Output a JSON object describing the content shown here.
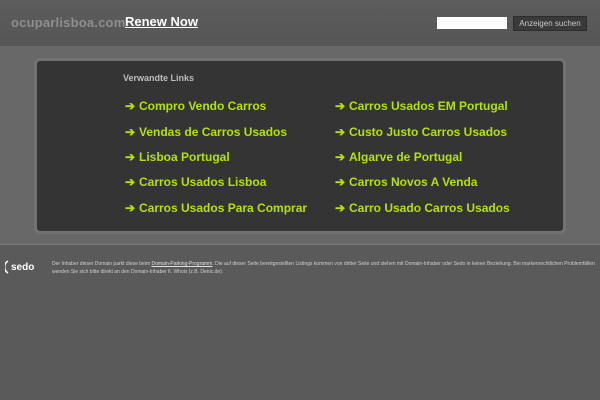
{
  "header": {
    "domain": "ocuparlisboa.com",
    "renew_label": "Renew Now",
    "search_placeholder": "",
    "search_button": "Anzeigen suchen"
  },
  "panel": {
    "title": "Verwandte Links",
    "arrow": "➔",
    "left_links": [
      "Compro Vendo Carros",
      "Vendas de Carros Usados",
      "Lisboa Portugal",
      "Carros Usados Lisboa",
      "Carros Usados Para Comprar"
    ],
    "right_links": [
      "Carros Usados EM Portugal",
      "Custo Justo Carros Usados",
      "Algarve de Portugal",
      "Carros Novos A Venda",
      "Carro Usado Carros Usados"
    ]
  },
  "footer": {
    "logo_text": "sedo",
    "text_before": "Der Inhaber dieser Domain parkt diese beim ",
    "parking_link": "Domain-Parking-Programm",
    "text_after": ". Die auf dieser Seite bereitgestellten Listings kommen von dritter Seite und stehen mit Domain-Inhaber oder Sedo in keiner Beziehung. Bei markenrechtlichen Problemfällen wenden Sie sich bitte direkt an den Domain-Inhaber lt. Whois (z.B. Denic.de)."
  },
  "colors": {
    "link": "#b3e400",
    "panel_bg": "#343434",
    "page_bg": "#5a5a5a"
  },
  "icons": [
    "arrow-right-icon",
    "sedo-logo-icon"
  ]
}
